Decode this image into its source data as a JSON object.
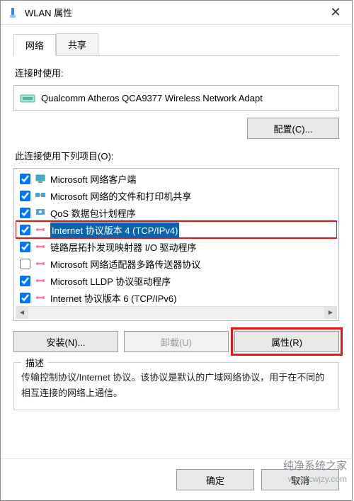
{
  "window": {
    "title": "WLAN 属性",
    "close_glyph": "✕"
  },
  "tabs": {
    "network": "网络",
    "sharing": "共享"
  },
  "labels": {
    "connect_using": "连接时使用:",
    "uses_items": "此连接使用下列项目(O):"
  },
  "adapter": {
    "name": "Qualcomm Atheros QCA9377 Wireless Network Adapt"
  },
  "buttons": {
    "configure": "配置(C)...",
    "install": "安装(N)...",
    "uninstall": "卸载(U)",
    "properties": "属性(R)",
    "ok": "确定",
    "cancel": "取消"
  },
  "items": [
    {
      "checked": true,
      "label": "Microsoft 网络客户端",
      "icon": "client"
    },
    {
      "checked": true,
      "label": "Microsoft 网络的文件和打印机共享",
      "icon": "share"
    },
    {
      "checked": true,
      "label": "QoS 数据包计划程序",
      "icon": "qos"
    },
    {
      "checked": true,
      "label": "Internet 协议版本 4 (TCP/IPv4)",
      "icon": "proto",
      "selected": true,
      "highlight": true
    },
    {
      "checked": true,
      "label": "链路层拓扑发现映射器 I/O 驱动程序",
      "icon": "proto"
    },
    {
      "checked": false,
      "label": "Microsoft 网络适配器多路传送器协议",
      "icon": "proto"
    },
    {
      "checked": true,
      "label": "Microsoft LLDP 协议驱动程序",
      "icon": "proto"
    },
    {
      "checked": true,
      "label": "Internet 协议版本 6 (TCP/IPv6)",
      "icon": "proto"
    }
  ],
  "description": {
    "legend": "描述",
    "text": "传输控制协议/Internet 协议。该协议是默认的广域网络协议，用于在不同的相互连接的网络上通信。"
  },
  "watermark": {
    "line1": "纯净系统之家",
    "line2": "www.cwjzy.com"
  }
}
